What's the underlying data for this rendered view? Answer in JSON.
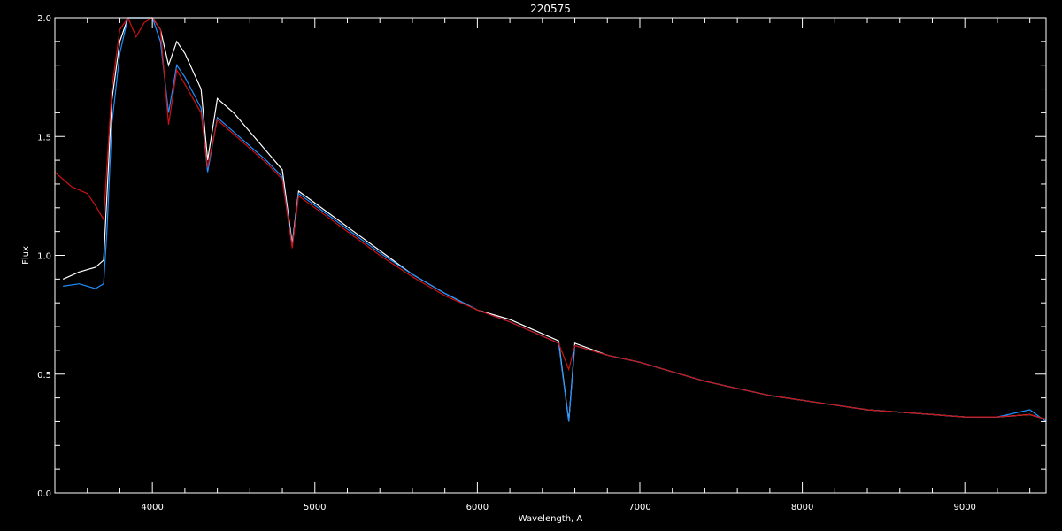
{
  "chart_data": {
    "type": "line",
    "title": "220575",
    "xlabel": "Wavelength, A",
    "ylabel": "Flux",
    "xlim": [
      3400,
      9500
    ],
    "ylim": [
      0.0,
      2.0
    ],
    "x_ticks": [
      4000,
      5000,
      6000,
      7000,
      8000,
      9000
    ],
    "x_tick_labels": [
      "4000",
      "5000",
      "6000",
      "7000",
      "8000",
      "9000"
    ],
    "y_ticks": [
      0.0,
      0.5,
      1.0,
      1.5,
      2.0
    ],
    "y_tick_labels": [
      "0.0",
      "0.5",
      "1.0",
      "1.5",
      "2.0"
    ],
    "colors": {
      "background": "#000000",
      "axes": "#ffffff",
      "white_series": "#ffffff",
      "blue_series": "#1e90ff",
      "red_series": "#cc1111"
    },
    "series": [
      {
        "color": "#ffffff",
        "x": [
          3450,
          3550,
          3650,
          3700,
          3720,
          3750,
          3800,
          3850,
          3900,
          3950,
          4000,
          4050,
          4100,
          4150,
          4200,
          4300,
          4340,
          4400,
          4500,
          4600,
          4700,
          4800,
          4861,
          4900,
          5000,
          5200,
          5400,
          5600,
          5800,
          6000,
          6200,
          6400,
          6500,
          6563,
          6600,
          6800,
          7000,
          7200,
          7400,
          7600,
          7800,
          8000,
          8200,
          8400,
          8600,
          8800,
          9000,
          9200,
          9400,
          9500
        ],
        "y": [
          0.9,
          0.93,
          0.95,
          0.98,
          1.25,
          1.65,
          1.9,
          2.0,
          2.0,
          2.0,
          2.0,
          1.95,
          1.8,
          1.9,
          1.85,
          1.7,
          1.4,
          1.66,
          1.6,
          1.52,
          1.44,
          1.36,
          1.05,
          1.27,
          1.22,
          1.12,
          1.02,
          0.92,
          0.84,
          0.77,
          0.73,
          0.67,
          0.64,
          0.3,
          0.63,
          0.58,
          0.55,
          0.51,
          0.47,
          0.44,
          0.41,
          0.39,
          0.37,
          0.35,
          0.34,
          0.33,
          0.32,
          0.32,
          0.33,
          0.31
        ]
      },
      {
        "color": "#1e90ff",
        "x": [
          3450,
          3550,
          3650,
          3700,
          3720,
          3750,
          3800,
          3850,
          3900,
          3950,
          4000,
          4050,
          4100,
          4150,
          4200,
          4300,
          4340,
          4400,
          4500,
          4600,
          4700,
          4800,
          4861,
          4900,
          5000,
          5200,
          5400,
          5600,
          5800,
          6000,
          6200,
          6400,
          6500,
          6563,
          6600,
          6800,
          7000,
          7200,
          7400,
          7600,
          7800,
          8000,
          8200,
          8400,
          8600,
          8800,
          9000,
          9200,
          9400,
          9500
        ],
        "y": [
          0.87,
          0.88,
          0.86,
          0.88,
          1.1,
          1.55,
          1.85,
          2.0,
          2.0,
          2.0,
          2.0,
          1.9,
          1.6,
          1.8,
          1.75,
          1.62,
          1.35,
          1.58,
          1.52,
          1.46,
          1.4,
          1.33,
          1.04,
          1.26,
          1.21,
          1.11,
          1.01,
          0.92,
          0.84,
          0.77,
          0.72,
          0.66,
          0.63,
          0.3,
          0.62,
          0.58,
          0.55,
          0.51,
          0.47,
          0.44,
          0.41,
          0.39,
          0.37,
          0.35,
          0.34,
          0.33,
          0.32,
          0.32,
          0.35,
          0.3
        ]
      },
      {
        "color": "#cc1111",
        "x": [
          3400,
          3500,
          3600,
          3650,
          3700,
          3750,
          3800,
          3850,
          3900,
          3950,
          4000,
          4050,
          4100,
          4150,
          4200,
          4300,
          4340,
          4400,
          4500,
          4600,
          4700,
          4800,
          4861,
          4900,
          5000,
          5200,
          5400,
          5600,
          5800,
          6000,
          6200,
          6400,
          6500,
          6563,
          6600,
          6800,
          7000,
          7200,
          7400,
          7600,
          7800,
          8000,
          8200,
          8400,
          8600,
          8800,
          9000,
          9200,
          9400,
          9500
        ],
        "y": [
          1.35,
          1.29,
          1.26,
          1.21,
          1.15,
          1.7,
          1.95,
          2.0,
          1.92,
          1.98,
          2.0,
          1.95,
          1.55,
          1.78,
          1.72,
          1.6,
          1.37,
          1.57,
          1.51,
          1.45,
          1.39,
          1.32,
          1.03,
          1.25,
          1.2,
          1.1,
          1.0,
          0.91,
          0.83,
          0.77,
          0.72,
          0.66,
          0.63,
          0.52,
          0.62,
          0.58,
          0.55,
          0.51,
          0.47,
          0.44,
          0.41,
          0.39,
          0.37,
          0.35,
          0.34,
          0.33,
          0.32,
          0.32,
          0.33,
          0.31
        ]
      }
    ]
  }
}
